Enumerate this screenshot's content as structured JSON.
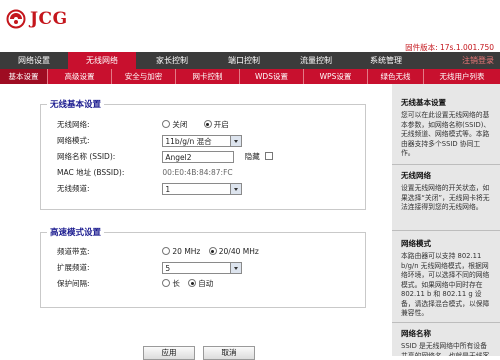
{
  "header": {
    "logo_text": "JCG",
    "firmware": "固件版本: 17s.1.001.750"
  },
  "main_nav": [
    {
      "label": "网络设置",
      "active": false
    },
    {
      "label": "无线网络",
      "active": true
    },
    {
      "label": "家长控制",
      "active": false
    },
    {
      "label": "端口控制",
      "active": false
    },
    {
      "label": "流量控制",
      "active": false
    },
    {
      "label": "系统管理",
      "active": false
    }
  ],
  "main_nav_right": "注销登录",
  "sub_nav": [
    {
      "label": "基本设置",
      "active": true
    },
    {
      "label": "高级设置",
      "active": false
    },
    {
      "label": "安全与加密",
      "active": false
    },
    {
      "label": "网卡控制",
      "active": false
    },
    {
      "label": "WDS设置",
      "active": false
    },
    {
      "label": "WPS设置",
      "active": false
    },
    {
      "label": "绿色无线",
      "active": false
    },
    {
      "label": "无线用户列表",
      "active": false
    }
  ],
  "basic": {
    "legend": "无线基本设置",
    "wireless_label": "无线网络:",
    "wireless_off": "关闭",
    "wireless_on": "开启",
    "mode_label": "网络模式:",
    "mode_value": "11b/g/n 混合",
    "ssid_label": "网络名称 (SSID):",
    "ssid_value": "Angel2",
    "hide_label": "隐藏",
    "mac_label": "MAC 地址 (BSSID):",
    "mac_value": "00:E0:4B:84:87:FC",
    "channel_label": "无线频道:",
    "channel_value": "1"
  },
  "advanced": {
    "legend": "高速模式设置",
    "bandwidth_label": "频道带宽:",
    "bw_20": "20 MHz",
    "bw_2040": "20/40 MHz",
    "ext_label": "扩展频道:",
    "ext_value": "5",
    "guard_label": "保护间隔:",
    "guard_long": "长",
    "guard_auto": "自动"
  },
  "buttons": {
    "apply": "应用",
    "cancel": "取消"
  },
  "help": [
    {
      "title": "无线基本设置",
      "text": "您可以在此设置无线网络的基本参数，如网络名称(SSID)、无线频道、网络模式等。本路由器支持多个SSID 协同工作。"
    },
    {
      "title": "无线网络",
      "text": "设置无线网络的开关状态，如果选择“关闭”，无线网卡将无法连接得到您的无线网络。"
    },
    {
      "title": "网络模式",
      "text": "本路由器可以支持 802.11 b/g/n 无线网络模式，根据网络环境，可以选择不同的网络模式。如果网络中同时存在 802.11 b 和 802.11 g 设备，请选择混合模式，以保障兼容性。"
    },
    {
      "title": "网络名称",
      "text": "SSID 是无线网络中所有设备共享的网络名，也就是无线客户端可以搜索到的无线网络"
    }
  ],
  "colors": {
    "accent_red": "#c8102e",
    "nav_dark": "#3b3b3b",
    "legend_blue": "#1b1b8f"
  }
}
